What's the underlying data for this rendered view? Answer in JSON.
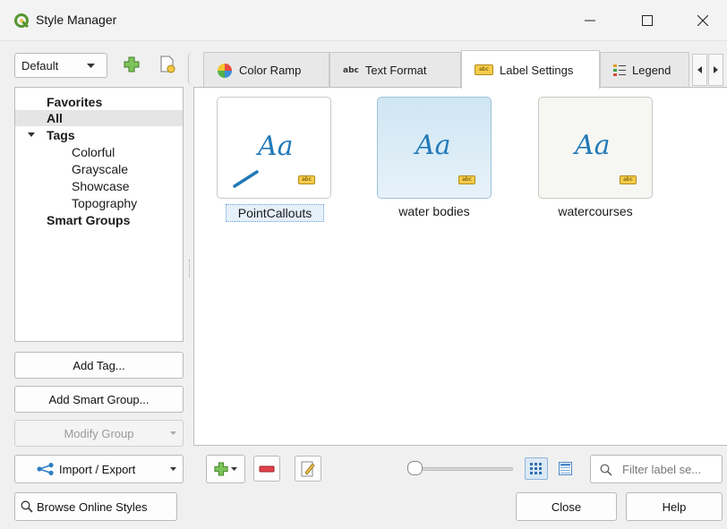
{
  "window": {
    "title": "Style Manager",
    "minimize_glyph": "—",
    "maximize_glyph": "☐",
    "close_glyph": "✕"
  },
  "library": {
    "selected": "Default"
  },
  "tabs": [
    {
      "label": "Color Ramp",
      "icon": "color-ramp-icon"
    },
    {
      "label": "Text Format",
      "icon": "text-format-icon"
    },
    {
      "label": "Label Settings",
      "icon": "label-settings-icon",
      "active": true
    },
    {
      "label": "Legend",
      "icon": "legend-icon"
    }
  ],
  "tree": {
    "favorites": "Favorites",
    "all": "All",
    "tags": "Tags",
    "tag_items": [
      "Colorful",
      "Grayscale",
      "Showcase",
      "Topography"
    ],
    "smart_groups": "Smart Groups"
  },
  "left_buttons": {
    "add_tag": "Add Tag...",
    "add_smart_group": "Add Smart Group...",
    "modify_group": "Modify Group",
    "import_export": "Import / Export",
    "browse_online": "Browse Online Styles"
  },
  "styles": [
    {
      "name": "PointCallouts",
      "sample": "Aa",
      "selected": true
    },
    {
      "name": "water bodies",
      "sample": "Aa"
    },
    {
      "name": "watercourses",
      "sample": "Aa"
    }
  ],
  "abc_tag_text": "abc",
  "filter": {
    "placeholder": "Filter label se..."
  },
  "bottom_buttons": {
    "close": "Close",
    "help": "Help"
  }
}
